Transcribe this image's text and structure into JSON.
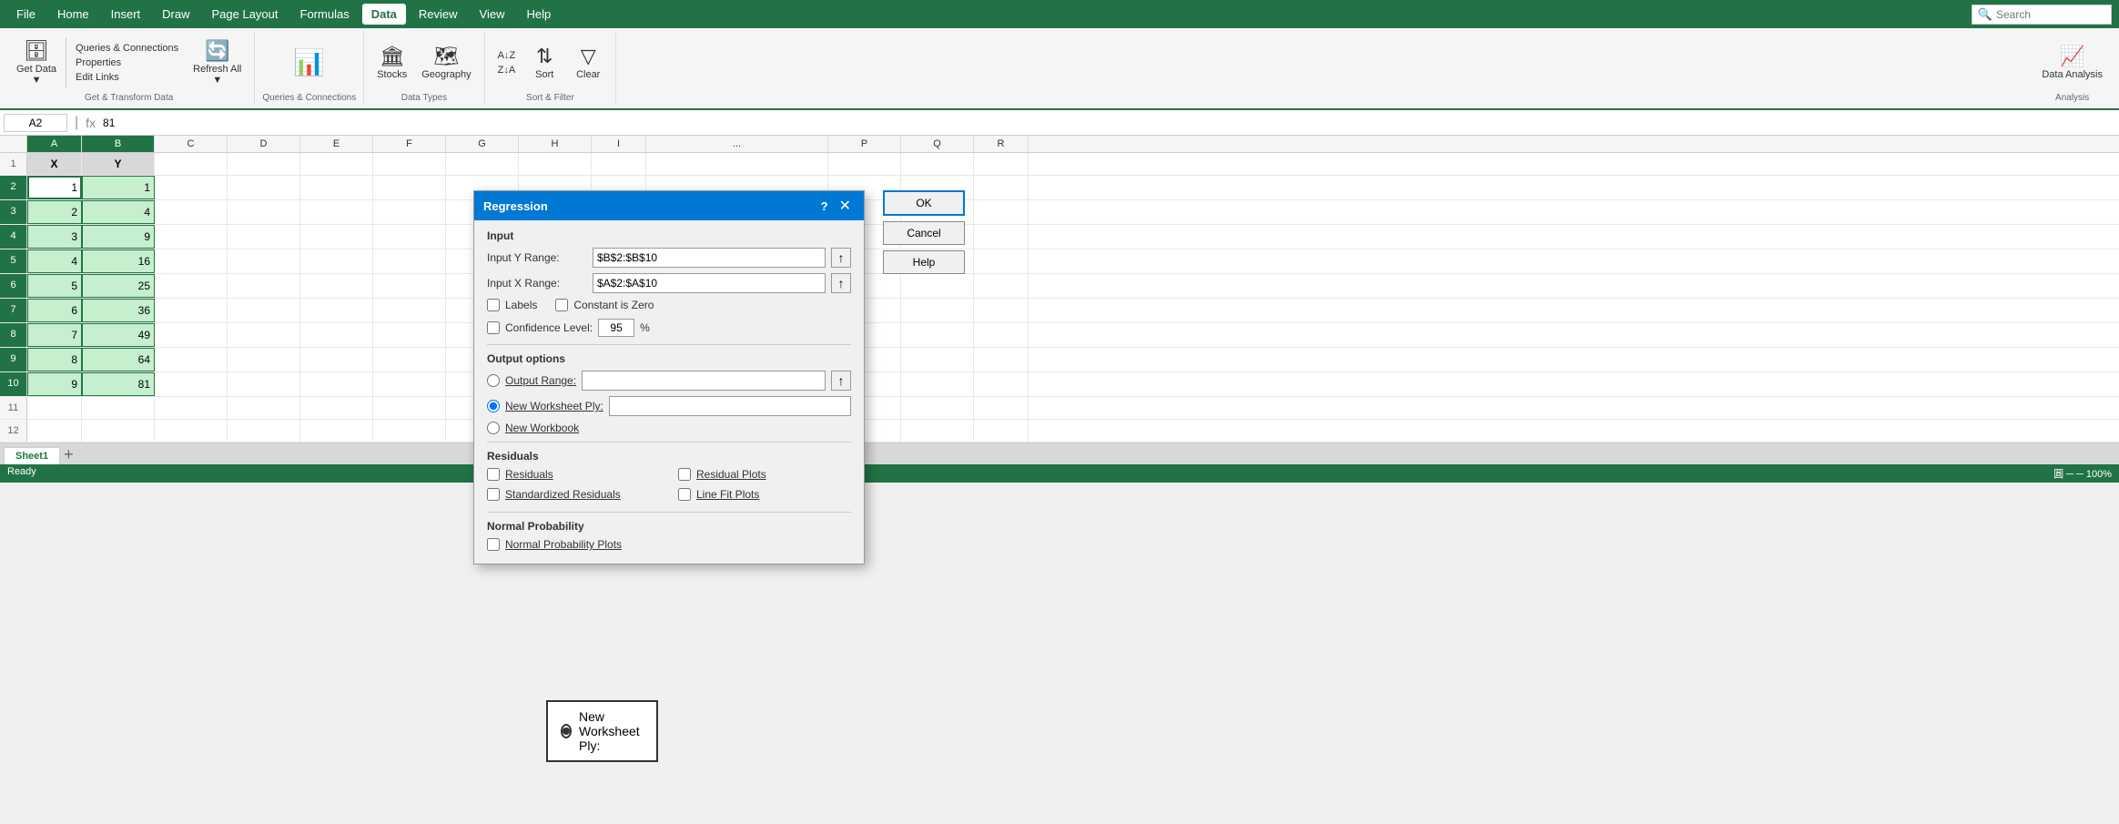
{
  "menubar": {
    "items": [
      "File",
      "Home",
      "Insert",
      "Draw",
      "Page Layout",
      "Formulas",
      "Data",
      "Review",
      "View",
      "Help"
    ],
    "active": "Data",
    "search_placeholder": "Search"
  },
  "ribbon": {
    "get_transform": {
      "label": "Get & Transform Data",
      "get_data_label": "Get Data",
      "get_data_icon": "🗄",
      "queries_btn": "Queries & Connections",
      "properties_btn": "Properties",
      "edit_links_btn": "Edit Links",
      "refresh_icon": "🔄",
      "refresh_label": "Refresh\nAll"
    },
    "queries_connections": {
      "label": "Queries & Connections"
    },
    "data_types": {
      "label": "Data Types",
      "stocks_icon": "🏛",
      "stocks_label": "Stocks",
      "geography_icon": "🗺",
      "geography_label": "Geography"
    },
    "sort_filter": {
      "label": "Sort & Filter",
      "sort_az": "A↓Z",
      "sort_za": "Z↓A",
      "sort_label": "Sort",
      "filter_icon": "▽",
      "clear_label": "Clear"
    },
    "analysis": {
      "label": "Analysis",
      "data_analysis_label": "Data Analysis"
    }
  },
  "formula_bar": {
    "cell_ref": "A2",
    "formula": "81"
  },
  "spreadsheet": {
    "col_headers": [
      "",
      "A",
      "B",
      "C",
      "D",
      "E",
      "F",
      "G",
      "H",
      "I",
      "...",
      "P",
      "Q",
      "R"
    ],
    "rows": [
      {
        "num": "1",
        "a": "X",
        "b": "Y"
      },
      {
        "num": "2",
        "a": "1",
        "b": "1"
      },
      {
        "num": "3",
        "a": "2",
        "b": "4"
      },
      {
        "num": "4",
        "a": "3",
        "b": "9"
      },
      {
        "num": "5",
        "a": "4",
        "b": "16"
      },
      {
        "num": "6",
        "a": "5",
        "b": "25"
      },
      {
        "num": "7",
        "a": "6",
        "b": "36"
      },
      {
        "num": "8",
        "a": "7",
        "b": "49"
      },
      {
        "num": "9",
        "a": "8",
        "b": "64"
      },
      {
        "num": "10",
        "a": "9",
        "b": "81"
      },
      {
        "num": "11",
        "a": "",
        "b": ""
      },
      {
        "num": "12",
        "a": "",
        "b": ""
      }
    ]
  },
  "dialog": {
    "title": "Regression",
    "question_mark": "?",
    "sections": {
      "input": {
        "label": "Input",
        "y_range_label": "Input Y Range:",
        "y_range_value": "$B$2:$B$10",
        "x_range_label": "Input X Range:",
        "x_range_value": "$A$2:$A$10"
      },
      "options": {
        "labels_label": "Labels",
        "constant_zero_label": "Constant is Zero",
        "confidence_label": "Confidence Level:",
        "confidence_value": "95",
        "confidence_unit": "%"
      },
      "output": {
        "label": "Output options",
        "output_range_label": "Output Range:",
        "new_worksheet_label": "New Worksheet Ply:",
        "new_workbook_label": "New Workbook"
      },
      "residuals": {
        "label": "Residuals",
        "residuals_label": "Residuals",
        "residual_plots_label": "Residual Plots",
        "std_residuals_label": "Standardized Residuals",
        "line_fit_label": "Line Fit Plots"
      },
      "normal": {
        "label": "Normal Probability",
        "normal_prob_label": "Normal Probability Plots"
      }
    },
    "buttons": {
      "ok": "OK",
      "cancel": "Cancel",
      "help": "Help"
    }
  },
  "callout": {
    "label": "New Worksheet Ply:"
  },
  "sheet_tabs": [
    "Sheet1"
  ],
  "status_bar": {
    "left": "Ready",
    "right": "圓  ─  ─  100%"
  }
}
